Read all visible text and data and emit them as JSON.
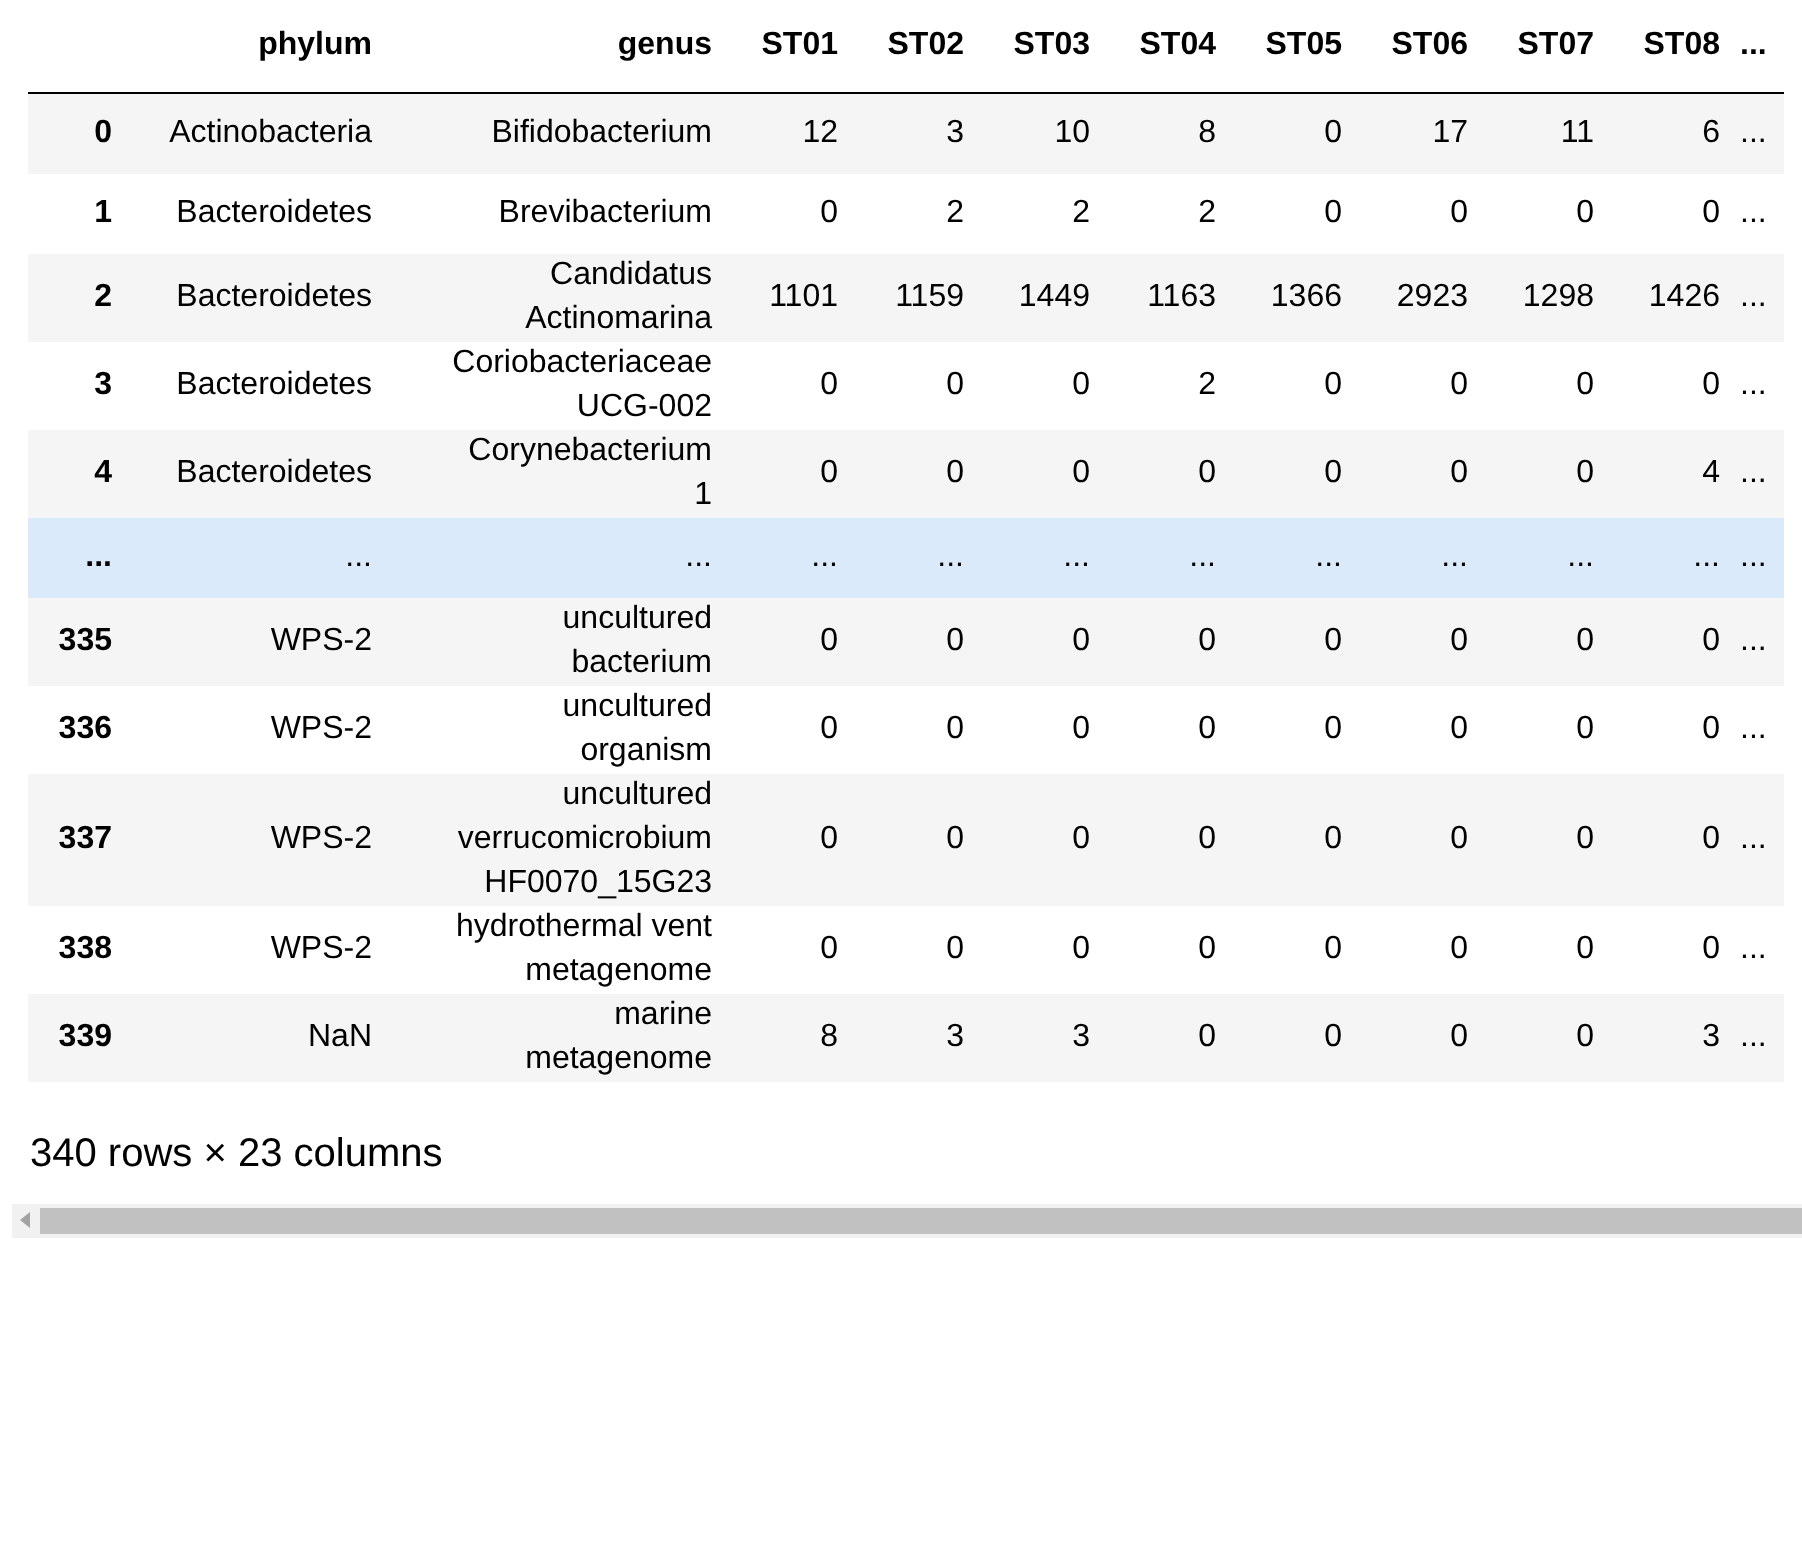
{
  "table": {
    "columns": [
      "phylum",
      "genus",
      "ST01",
      "ST02",
      "ST03",
      "ST04",
      "ST05",
      "ST06",
      "ST07",
      "ST08",
      "..."
    ],
    "rows": [
      {
        "index": "0",
        "highlighted": false,
        "cells": [
          "Actinobacteria",
          "Bifidobacterium",
          "12",
          "3",
          "10",
          "8",
          "0",
          "17",
          "11",
          "6",
          "..."
        ]
      },
      {
        "index": "1",
        "highlighted": false,
        "cells": [
          "Bacteroidetes",
          "Brevibacterium",
          "0",
          "2",
          "2",
          "2",
          "0",
          "0",
          "0",
          "0",
          "..."
        ]
      },
      {
        "index": "2",
        "highlighted": false,
        "cells": [
          "Bacteroidetes",
          "Candidatus\nActinomarina",
          "1101",
          "1159",
          "1449",
          "1163",
          "1366",
          "2923",
          "1298",
          "1426",
          "..."
        ]
      },
      {
        "index": "3",
        "highlighted": false,
        "cells": [
          "Bacteroidetes",
          "Coriobacteriaceae\nUCG-002",
          "0",
          "0",
          "0",
          "2",
          "0",
          "0",
          "0",
          "0",
          "..."
        ]
      },
      {
        "index": "4",
        "highlighted": false,
        "cells": [
          "Bacteroidetes",
          "Corynebacterium\n1",
          "0",
          "0",
          "0",
          "0",
          "0",
          "0",
          "0",
          "4",
          "..."
        ]
      },
      {
        "index": "...",
        "highlighted": true,
        "cells": [
          "...",
          "...",
          "...",
          "...",
          "...",
          "...",
          "...",
          "...",
          "...",
          "...",
          "..."
        ]
      },
      {
        "index": "335",
        "highlighted": false,
        "cells": [
          "WPS-2",
          "uncultured\nbacterium",
          "0",
          "0",
          "0",
          "0",
          "0",
          "0",
          "0",
          "0",
          "..."
        ]
      },
      {
        "index": "336",
        "highlighted": false,
        "cells": [
          "WPS-2",
          "uncultured\norganism",
          "0",
          "0",
          "0",
          "0",
          "0",
          "0",
          "0",
          "0",
          "..."
        ]
      },
      {
        "index": "337",
        "highlighted": false,
        "cells": [
          "WPS-2",
          "uncultured\nverrucomicrobium\nHF0070_15G23",
          "0",
          "0",
          "0",
          "0",
          "0",
          "0",
          "0",
          "0",
          "..."
        ]
      },
      {
        "index": "338",
        "highlighted": false,
        "cells": [
          "WPS-2",
          "hydrothermal vent\nmetagenome",
          "0",
          "0",
          "0",
          "0",
          "0",
          "0",
          "0",
          "0",
          "..."
        ]
      },
      {
        "index": "339",
        "highlighted": false,
        "cells": [
          "NaN",
          "marine\nmetagenome",
          "8",
          "3",
          "3",
          "0",
          "0",
          "0",
          "0",
          "3",
          "..."
        ]
      }
    ]
  },
  "footer": "340 rows × 23 columns"
}
